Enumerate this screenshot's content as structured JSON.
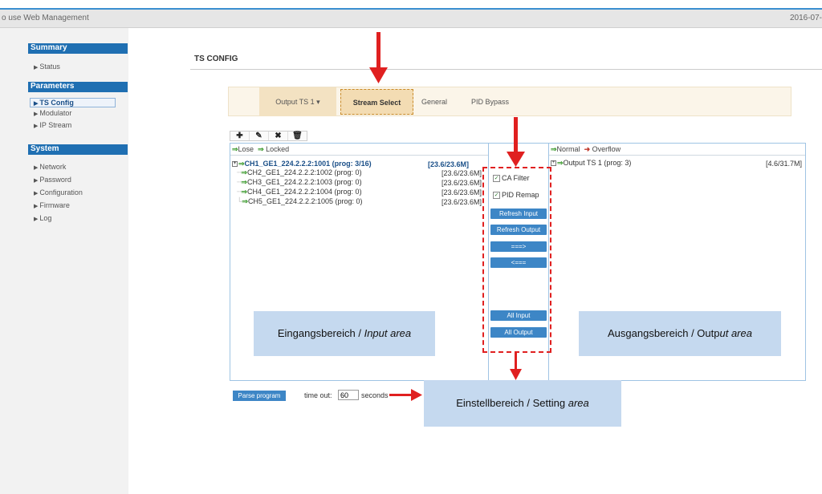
{
  "header": {
    "title": "o use Web Management",
    "date": "2016-07-"
  },
  "sidebar": {
    "summary": {
      "title": "Summary",
      "items": [
        "Status"
      ]
    },
    "parameters": {
      "title": "Parameters",
      "items": [
        "TS Config",
        "Modulator",
        "IP Stream"
      ],
      "active": "TS Config"
    },
    "system": {
      "title": "System",
      "items": [
        "Network",
        "Password",
        "Configuration",
        "Firmware",
        "Log"
      ]
    }
  },
  "page": {
    "title": "TS CONFIG"
  },
  "tabs": {
    "output": "Output TS 1 ▾",
    "stream_select": "Stream Select",
    "general": "General",
    "pid_bypass": "PID Bypass"
  },
  "toolbar": {
    "add": "✚",
    "edit": "✎",
    "delete": "✖",
    "trash": "🗑"
  },
  "input": {
    "legend_lose": "Lose",
    "legend_locked": "Locked",
    "channels": [
      {
        "name": "CH1_GE1_224.2.2.2:1001 (prog: 3/16)",
        "rate": "[23.6/23.6M]"
      },
      {
        "name": "CH2_GE1_224.2.2.2:1002 (prog: 0)",
        "rate": "[23.6/23.6M]"
      },
      {
        "name": "CH3_GE1_224.2.2.2:1003 (prog: 0)",
        "rate": "[23.6/23.6M]"
      },
      {
        "name": "CH4_GE1_224.2.2.2:1004 (prog: 0)",
        "rate": "[23.6/23.6M]"
      },
      {
        "name": "CH5_GE1_224.2.2.2:1005 (prog: 0)",
        "rate": "[23.6/23.6M]"
      }
    ]
  },
  "output": {
    "legend_normal": "Normal",
    "legend_overflow": "Overflow",
    "items": [
      {
        "name": "Output TS 1 (prog: 3)",
        "rate": "[4.6/31.7M]"
      }
    ]
  },
  "settings": {
    "ca_filter": "CA Filter",
    "pid_remap": "PID Remap",
    "refresh_input": "Refresh Input",
    "refresh_output": "Refresh Output",
    "move_right": "===>",
    "move_left": "<===",
    "all_input": "All Input",
    "all_output": "All Output"
  },
  "bottom": {
    "parse_program": "Parse program",
    "timeout_label": "time out:",
    "timeout_value": "60",
    "seconds": "seconds"
  },
  "annotations": {
    "input_area_de": "Eingangsbereich / ",
    "input_area_en": "Input area",
    "output_area_de": "Ausgangsbereich / Outp",
    "output_area_en": "ut area",
    "setting_area_de": "Einstellbereich / Setting ",
    "setting_area_en": "area"
  },
  "colors": {
    "accent": "#1f6fb2",
    "button": "#3d86c6",
    "annotation_red": "#e02020",
    "callout": "#c5d9ef"
  }
}
